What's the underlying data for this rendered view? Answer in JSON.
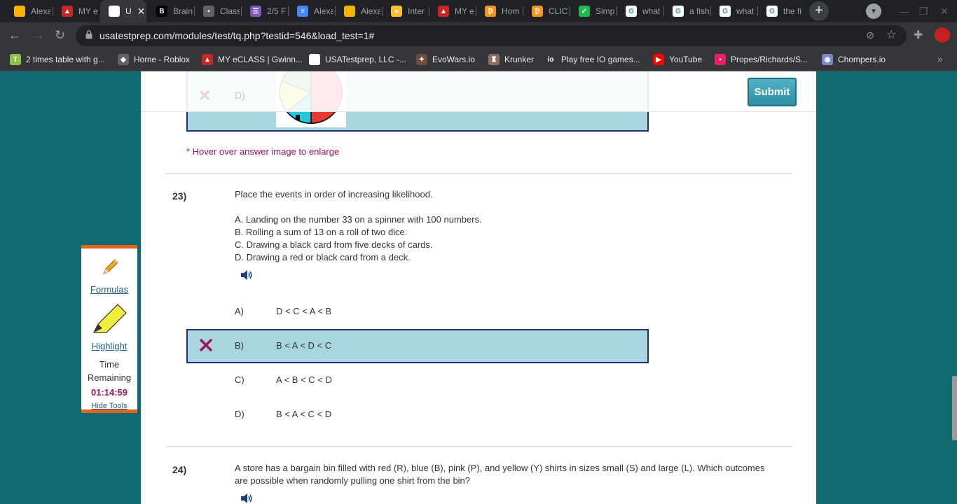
{
  "browser": {
    "tabs": [
      {
        "title": "Alexa",
        "icon": "slides-icon",
        "color": "#f4b400",
        "glyph": ""
      },
      {
        "title": "MY e",
        "icon": "eclass-icon",
        "color": "#c62828",
        "glyph": "▲"
      },
      {
        "title": "U",
        "icon": "usatestprep-icon",
        "color": "#ffffff",
        "glyph": "",
        "active": true
      },
      {
        "title": "Brain",
        "icon": "brainly-icon",
        "color": "#000000",
        "glyph": "B"
      },
      {
        "title": "Class",
        "icon": "classroom-icon",
        "color": "#5f6368",
        "glyph": "▪"
      },
      {
        "title": "2/5 F",
        "icon": "forms-icon",
        "color": "#7e57c2",
        "glyph": "☰"
      },
      {
        "title": "Alexa",
        "icon": "docs-icon",
        "color": "#4285f4",
        "glyph": "≡"
      },
      {
        "title": "Alexa",
        "icon": "slides-icon",
        "color": "#f4b400",
        "glyph": ""
      },
      {
        "title": "Inter",
        "icon": "bulb-icon",
        "color": "#fbc02d",
        "glyph": "●"
      },
      {
        "title": "MY e",
        "icon": "eclass-icon",
        "color": "#c62828",
        "glyph": "▲"
      },
      {
        "title": "Hom",
        "icon": "bitcoin-icon",
        "color": "#f7931a",
        "glyph": "₿"
      },
      {
        "title": "CLIC",
        "icon": "bitcoin-icon",
        "color": "#f7931a",
        "glyph": "₿"
      },
      {
        "title": "Simp",
        "icon": "check-icon",
        "color": "#1db954",
        "glyph": "✓"
      },
      {
        "title": "what",
        "icon": "google-icon",
        "color": "#ffffff",
        "glyph": "G"
      },
      {
        "title": "a fish",
        "icon": "google-icon",
        "color": "#ffffff",
        "glyph": "G"
      },
      {
        "title": "what",
        "icon": "google-icon",
        "color": "#ffffff",
        "glyph": "G"
      },
      {
        "title": "the fi",
        "icon": "google-icon",
        "color": "#ffffff",
        "glyph": "G"
      }
    ],
    "url": "usatestprep.com/modules/test/tq.php?testid=546&load_test=1#",
    "bookmarks": [
      {
        "label": "2 times table with g...",
        "icon": "bookmark-icon",
        "color": "#8bc34a",
        "glyph": "T"
      },
      {
        "label": "Home - Roblox",
        "icon": "roblox-icon",
        "color": "#5f6368",
        "glyph": "◆"
      },
      {
        "label": "MY eCLASS | Gwinn...",
        "icon": "eclass-icon",
        "color": "#c62828",
        "glyph": "▲"
      },
      {
        "label": "USATestprep, LLC -...",
        "icon": "usatestprep-icon",
        "color": "#ffffff",
        "glyph": ""
      },
      {
        "label": "EvoWars.io",
        "icon": "evowars-icon",
        "color": "#6d4c41",
        "glyph": "✦"
      },
      {
        "label": "Krunker",
        "icon": "krunker-icon",
        "color": "#8d6e63",
        "glyph": "♜"
      },
      {
        "label": "Play free IO games...",
        "icon": "io-icon",
        "color": "#35363a",
        "glyph": "io"
      },
      {
        "label": "YouTube",
        "icon": "youtube-icon",
        "color": "#ff0000",
        "glyph": "▶"
      },
      {
        "label": "Propes/Richards/S...",
        "icon": "classroom-icon",
        "color": "#e91e63",
        "glyph": "▪"
      },
      {
        "label": "Chompers.io",
        "icon": "chompers-icon",
        "color": "#7986cb",
        "glyph": "◉"
      }
    ]
  },
  "test": {
    "submit_label": "Submit",
    "prev_answer_letter": "D)",
    "hover_note": "* Hover over answer image to enlarge",
    "question_23": {
      "number": "23)",
      "prompt": "Place the events in order of increasing likelihood.",
      "events": [
        "A. Landing on the number 33 on a spinner with 100 numbers.",
        "B. Rolling a sum of 13 on a roll of two dice.",
        "C. Drawing a black card from five decks of cards.",
        "D. Drawing a red or black card from a deck."
      ],
      "choices": [
        {
          "label": "A)",
          "answer": "D < C < A < B",
          "selected": false
        },
        {
          "label": "B)",
          "answer": "B < A < D < C",
          "selected": true
        },
        {
          "label": "C)",
          "answer": "A < B < C < D",
          "selected": false
        },
        {
          "label": "D)",
          "answer": "B < A < C < D",
          "selected": false
        }
      ]
    },
    "question_24": {
      "number": "24)",
      "prompt_line1": "A store has a bargain bin filled with red (R), blue (B), pink (P), and yellow (Y) shirts in sizes small (S) and large (L). Which outcomes",
      "prompt_line2": "are possible when randomly pulling one shirt from the bin?"
    }
  },
  "tools": {
    "formulas": "Formulas",
    "highlight": "Highlight",
    "time_label_1": "Time",
    "time_label_2": "Remaining",
    "time_remaining": "01:14:59",
    "hide_tools": "Hide Tools"
  },
  "colors": {
    "background": "#0f6b6f",
    "selected_fill": "#a9d5e0",
    "selected_border": "#21316b",
    "accent_magenta": "#a0125e",
    "tools_border": "#e2631e"
  }
}
